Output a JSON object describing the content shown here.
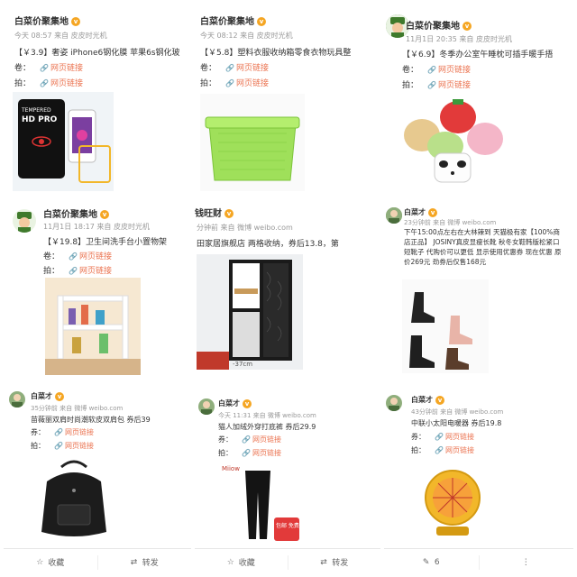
{
  "posts": [
    {
      "author": "白菜价聚集地",
      "meta": "今天 08:57 来自 皮皮时光机",
      "text": "【￥3.9】奢姿 iPhone6钢化膜 苹果6s钢化玻",
      "coupon_label": "卷：",
      "buy_label": "拍：",
      "link_label": "网页链接",
      "image_desc": "TEMPERED HD PRO 钢化膜"
    },
    {
      "author": "白菜价聚集地",
      "meta": "今天 08:12 来自 皮皮时光机",
      "text": "【￥5.8】塑料衣服收纳箱零食衣物玩具整",
      "coupon_label": "卷：",
      "buy_label": "拍：",
      "link_label": "网页链接"
    },
    {
      "author": "白菜价聚集地",
      "meta": "11月1日 20:35 来自 皮皮时光机",
      "text": "【￥6.9】冬季办公室午睡枕可插手暖手捂",
      "coupon_label": "卷：",
      "buy_label": "拍：",
      "link_label": "网页链接"
    },
    {
      "author": "白菜价聚集地",
      "meta": "11月1日 18:17 来自 皮皮时光机",
      "text": "【￥19.8】卫生间洗手台小置物架",
      "coupon_label": "卷：",
      "buy_label": "拍：",
      "link_label": "网页链接"
    },
    {
      "author": "钱旺财",
      "meta": "分钟前 来自 微博 weibo.com",
      "text": "田家居旗舰店 两格收纳，券后13.8，第",
      "image_caption": "-37cm"
    },
    {
      "author": "白菜才",
      "meta": "23分钟前 来自 微博 weibo.com",
      "text": "下午15:00点左右在大林辣到 天猫极有家【100%商店正品】 JOSINY真皮显瘦长靴 秋冬女鞋韩版松紧口短靴子 代购价可以更低 显示使用优惠券 现在优惠 原价269元 劲券后仅售168元"
    },
    {
      "author": "白菜才",
      "meta": "35分钟前 来自 微博 weibo.com",
      "text": "苗薇丽双肩时尚潮软皮双肩包 券后39",
      "coupon_label": "券：",
      "buy_label": "拍：",
      "link_label": "网页链接"
    },
    {
      "author": "白菜才",
      "meta": "今天 11:31 来自 微博 weibo.com",
      "text": "猫人加绒外穿打底裤 券后29.9",
      "coupon_label": "券：",
      "buy_label": "拍：",
      "link_label": "网页链接",
      "image_badge": "包邮 免费赠送"
    },
    {
      "author": "白菜才",
      "meta": "43分钟前 来自 微博 weibo.com",
      "text": "中联小太阳电暖器 券后19.8",
      "coupon_label": "券：",
      "buy_label": "拍：",
      "link_label": "网页链接"
    }
  ],
  "actions": {
    "collect": "收藏",
    "repost": "转发",
    "count": "6"
  },
  "colors": {
    "link": "#eb7350",
    "meta": "#999999",
    "badge": "#f5a623"
  }
}
